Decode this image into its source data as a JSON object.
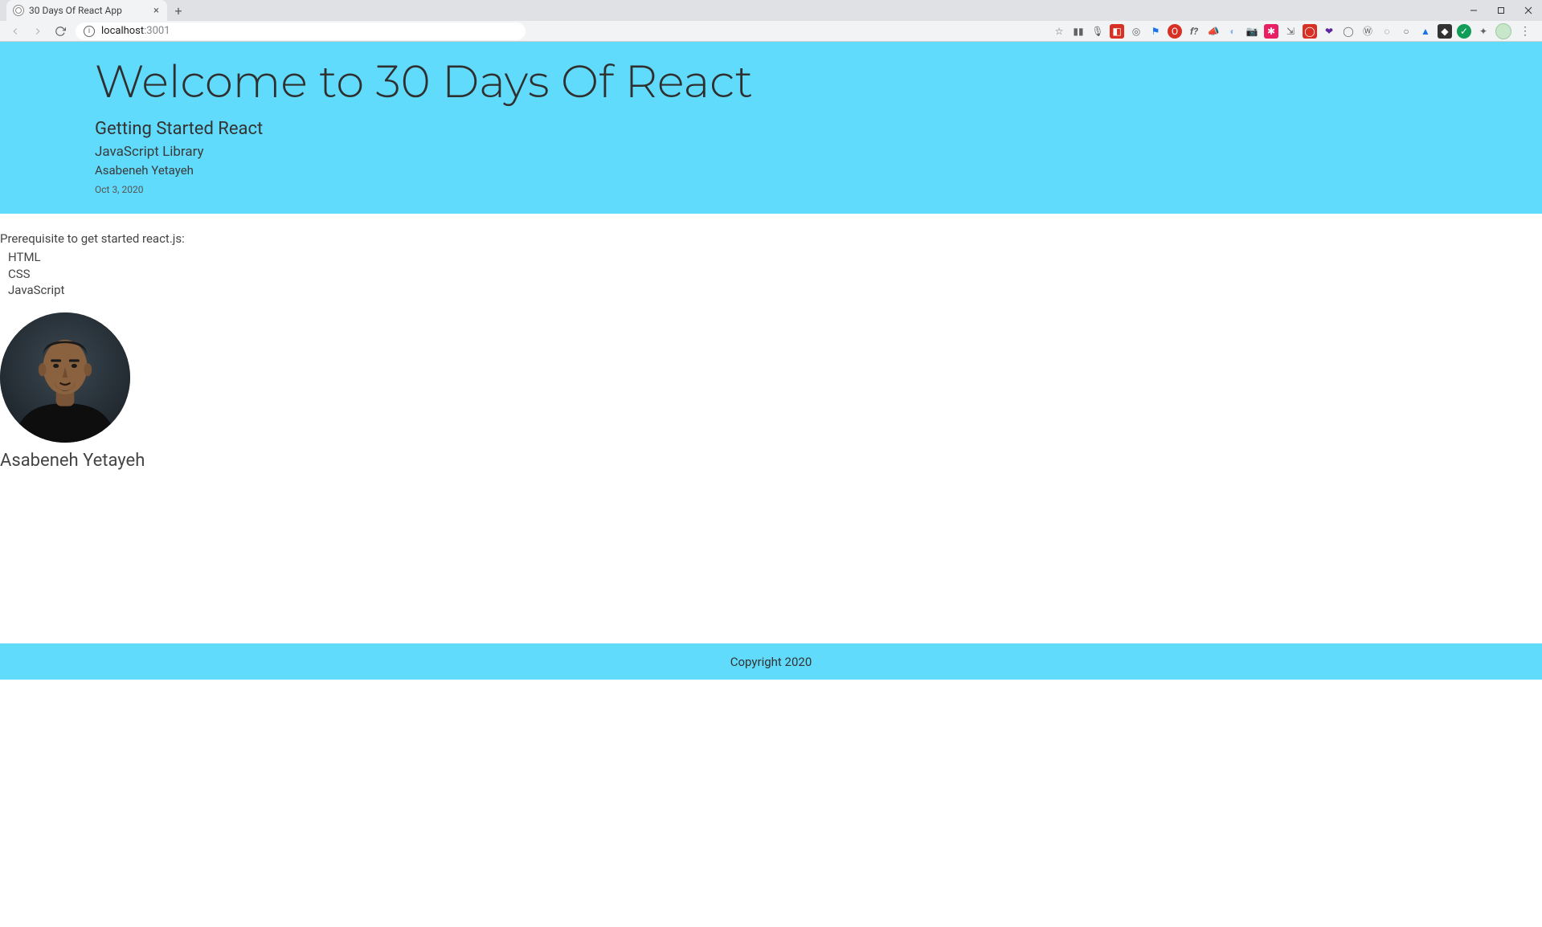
{
  "browser": {
    "tab_title": "30 Days Of React App",
    "url_host": "localhost",
    "url_port": ":3001"
  },
  "header": {
    "title": "Welcome to 30 Days Of React",
    "subtitle": "Getting Started React",
    "library": "JavaScript Library",
    "author": "Asabeneh Yetayeh",
    "date": "Oct 3, 2020"
  },
  "main": {
    "prereq_title": "Prerequisite to get started react.js:",
    "prereq_items": [
      "HTML",
      "CSS",
      "JavaScript"
    ],
    "user_name": "Asabeneh Yetayeh"
  },
  "footer": {
    "copyright": "Copyright 2020"
  }
}
